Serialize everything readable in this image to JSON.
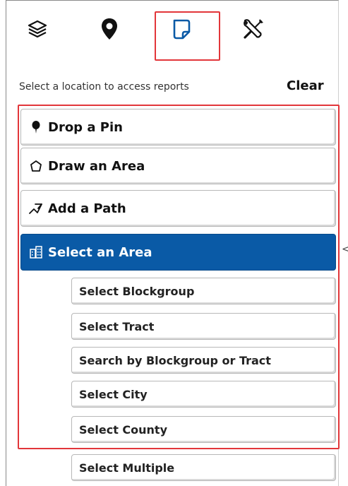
{
  "tabs": [
    {
      "name": "layers",
      "icon": "layers-icon"
    },
    {
      "name": "location",
      "icon": "map-pin-icon"
    },
    {
      "name": "reports",
      "icon": "document-icon",
      "selected": true
    },
    {
      "name": "tools",
      "icon": "tools-icon"
    }
  ],
  "hint_text": "Select a location to access reports",
  "clear_label": "Clear",
  "tools": {
    "drop_pin": "Drop a Pin",
    "draw_area": "Draw an Area",
    "add_path": "Add a Path",
    "select_area": "Select an Area"
  },
  "select_area_options": [
    "Select Blockgroup",
    "Select Tract",
    "Search by Blockgroup or Tract",
    "Select City",
    "Select County",
    "Select Multiple"
  ],
  "collapse_caret": "<",
  "colors": {
    "active_blue": "#0a5aa6",
    "highlight_red": "#e2363a"
  }
}
